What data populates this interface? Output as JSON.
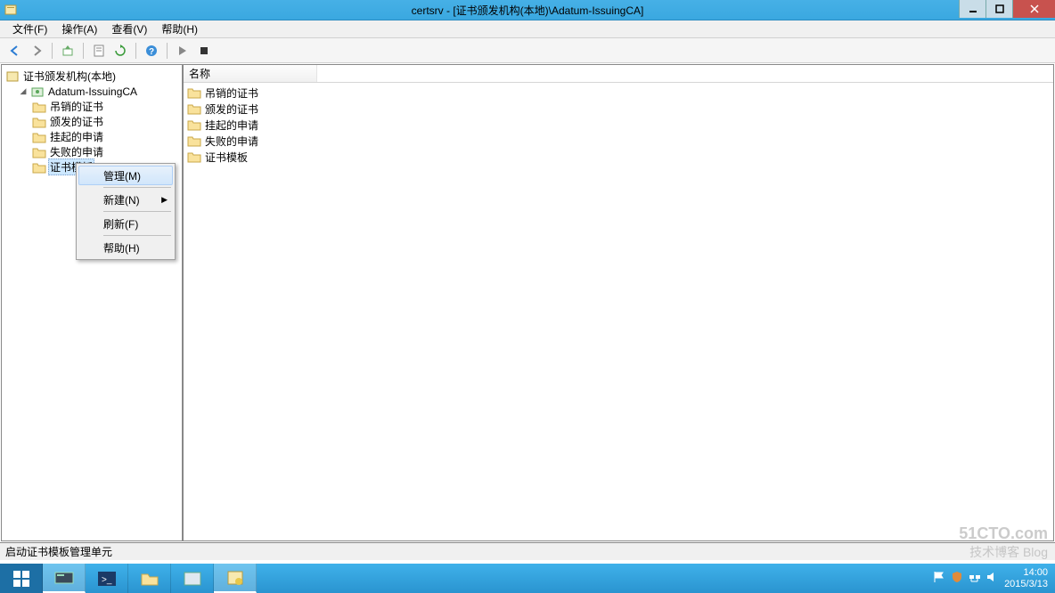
{
  "window": {
    "title": "certsrv - [证书颁发机构(本地)\\Adatum-IssuingCA]"
  },
  "menu": {
    "file": "文件(F)",
    "action": "操作(A)",
    "view": "查看(V)",
    "help": "帮助(H)"
  },
  "tree": {
    "root": "证书颁发机构(本地)",
    "ca": "Adatum-IssuingCA",
    "children": {
      "revoked": "吊销的证书",
      "issued": "颁发的证书",
      "pending": "挂起的申请",
      "failed": "失败的申请",
      "templates": "证书模板"
    }
  },
  "list": {
    "header_name": "名称",
    "rows": {
      "revoked": "吊销的证书",
      "issued": "颁发的证书",
      "pending": "挂起的申请",
      "failed": "失败的申请",
      "templates": "证书模板"
    }
  },
  "context_menu": {
    "manage": "管理(M)",
    "new": "新建(N)",
    "refresh": "刷新(F)",
    "help": "帮助(H)"
  },
  "status": "启动证书模板管理单元",
  "tray": {
    "time": "14:00",
    "date": "2015/3/13"
  },
  "watermark": {
    "line1": "51CTO.com",
    "line2": "技术博客  Blog"
  }
}
